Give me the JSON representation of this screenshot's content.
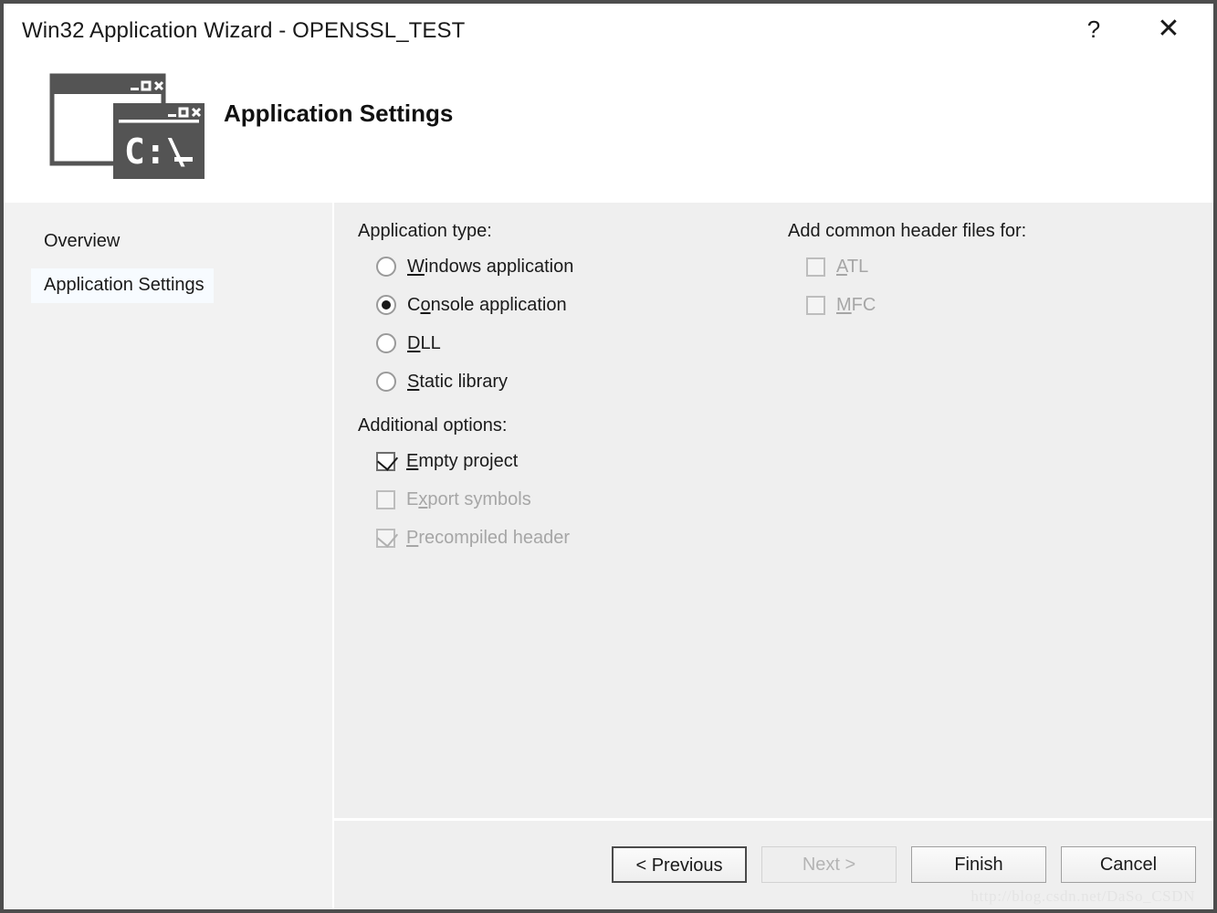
{
  "window": {
    "title": "Win32 Application Wizard - OPENSSL_TEST",
    "help_label": "?",
    "close_label": "✕"
  },
  "header": {
    "heading": "Application Settings",
    "icon": "console-window-icon",
    "icon_text": "C:\\_"
  },
  "sidebar": {
    "items": [
      {
        "label": "Overview",
        "selected": false
      },
      {
        "label": "Application Settings",
        "selected": true
      }
    ]
  },
  "main": {
    "application_type": {
      "label": "Application type:",
      "options": [
        {
          "label": "Windows application",
          "accel": "W",
          "accel_index": 0,
          "checked": false,
          "disabled": false
        },
        {
          "label": "Console application",
          "accel": "o",
          "accel_index": 1,
          "checked": true,
          "disabled": false
        },
        {
          "label": "DLL",
          "accel": "D",
          "accel_index": 0,
          "checked": false,
          "disabled": false
        },
        {
          "label": "Static library",
          "accel": "S",
          "accel_index": 0,
          "checked": false,
          "disabled": false
        }
      ]
    },
    "additional_options": {
      "label": "Additional options:",
      "options": [
        {
          "label": "Empty project",
          "accel": "E",
          "accel_index": 0,
          "checked": true,
          "disabled": false
        },
        {
          "label": "Export symbols",
          "accel": "x",
          "accel_index": 1,
          "checked": false,
          "disabled": true
        },
        {
          "label": "Precompiled header",
          "accel": "P",
          "accel_index": 0,
          "checked": true,
          "disabled": true
        }
      ]
    },
    "common_headers": {
      "label": "Add common header files for:",
      "options": [
        {
          "label": "ATL",
          "accel": "A",
          "accel_index": 0,
          "checked": false,
          "disabled": true
        },
        {
          "label": "MFC",
          "accel": "M",
          "accel_index": 0,
          "checked": false,
          "disabled": true
        }
      ]
    }
  },
  "footer": {
    "buttons": [
      {
        "label": "< Previous",
        "disabled": false,
        "focused": true
      },
      {
        "label": "Next >",
        "disabled": true,
        "focused": false
      },
      {
        "label": "Finish",
        "disabled": false,
        "focused": false
      },
      {
        "label": "Cancel",
        "disabled": false,
        "focused": false
      }
    ],
    "watermark": "http://blog.csdn.net/DaSo_CSDN"
  },
  "colors": {
    "frame_border": "#4d4d4d",
    "sidebar_bg": "#f2f2f2",
    "panel_bg": "#efefef",
    "selected_nav_bg": "#f7fbff",
    "text": "#1a1a1a",
    "disabled_text": "#a6a6a6",
    "icon_fill": "#545454"
  }
}
